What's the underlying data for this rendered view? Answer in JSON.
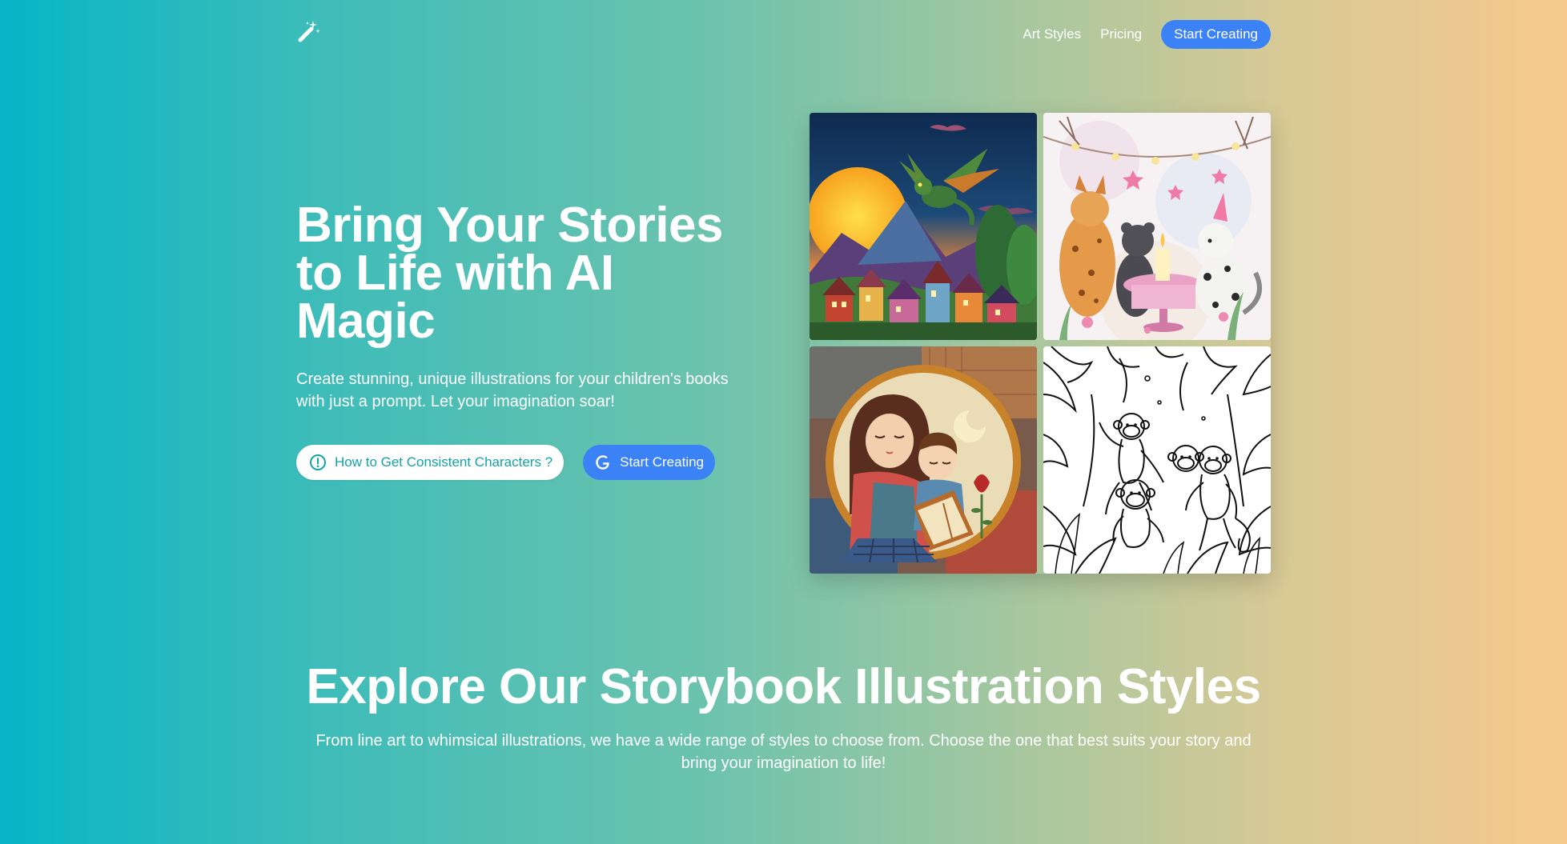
{
  "nav": {
    "logo_icon": "magic-wand-icon",
    "links": [
      {
        "label": "Art Styles"
      },
      {
        "label": "Pricing"
      }
    ],
    "cta_label": "Start Creating"
  },
  "hero": {
    "title": "Bring Your Stories to Life with AI Magic",
    "subtitle": "Create stunning, unique illustrations for your children's books with just a prompt. Let your imagination soar!",
    "guide_button_label": "How to Get Consistent Characters ?",
    "guide_button_icon": "info-circle-icon",
    "start_button_label": "Start Creating",
    "start_button_icon": "google-g-icon"
  },
  "gallery": {
    "images": [
      {
        "subject": "dragon-over-village-sunset"
      },
      {
        "subject": "watercolor-animals-tea-party"
      },
      {
        "subject": "mother-and-child-reading-quilt"
      },
      {
        "subject": "monkeys-jungle-line-art"
      }
    ]
  },
  "styles_section": {
    "title": "Explore Our Storybook Illustration Styles",
    "subtitle": "From line art to whimsical illustrations, we have a wide range of styles to choose from. Choose the one that best suits your story and bring your imagination to life!"
  },
  "colors": {
    "gradient_start": "#06b6c6",
    "gradient_end": "#f7c98d",
    "accent_blue": "#3b82f6",
    "teal_text": "#14a3a8"
  }
}
